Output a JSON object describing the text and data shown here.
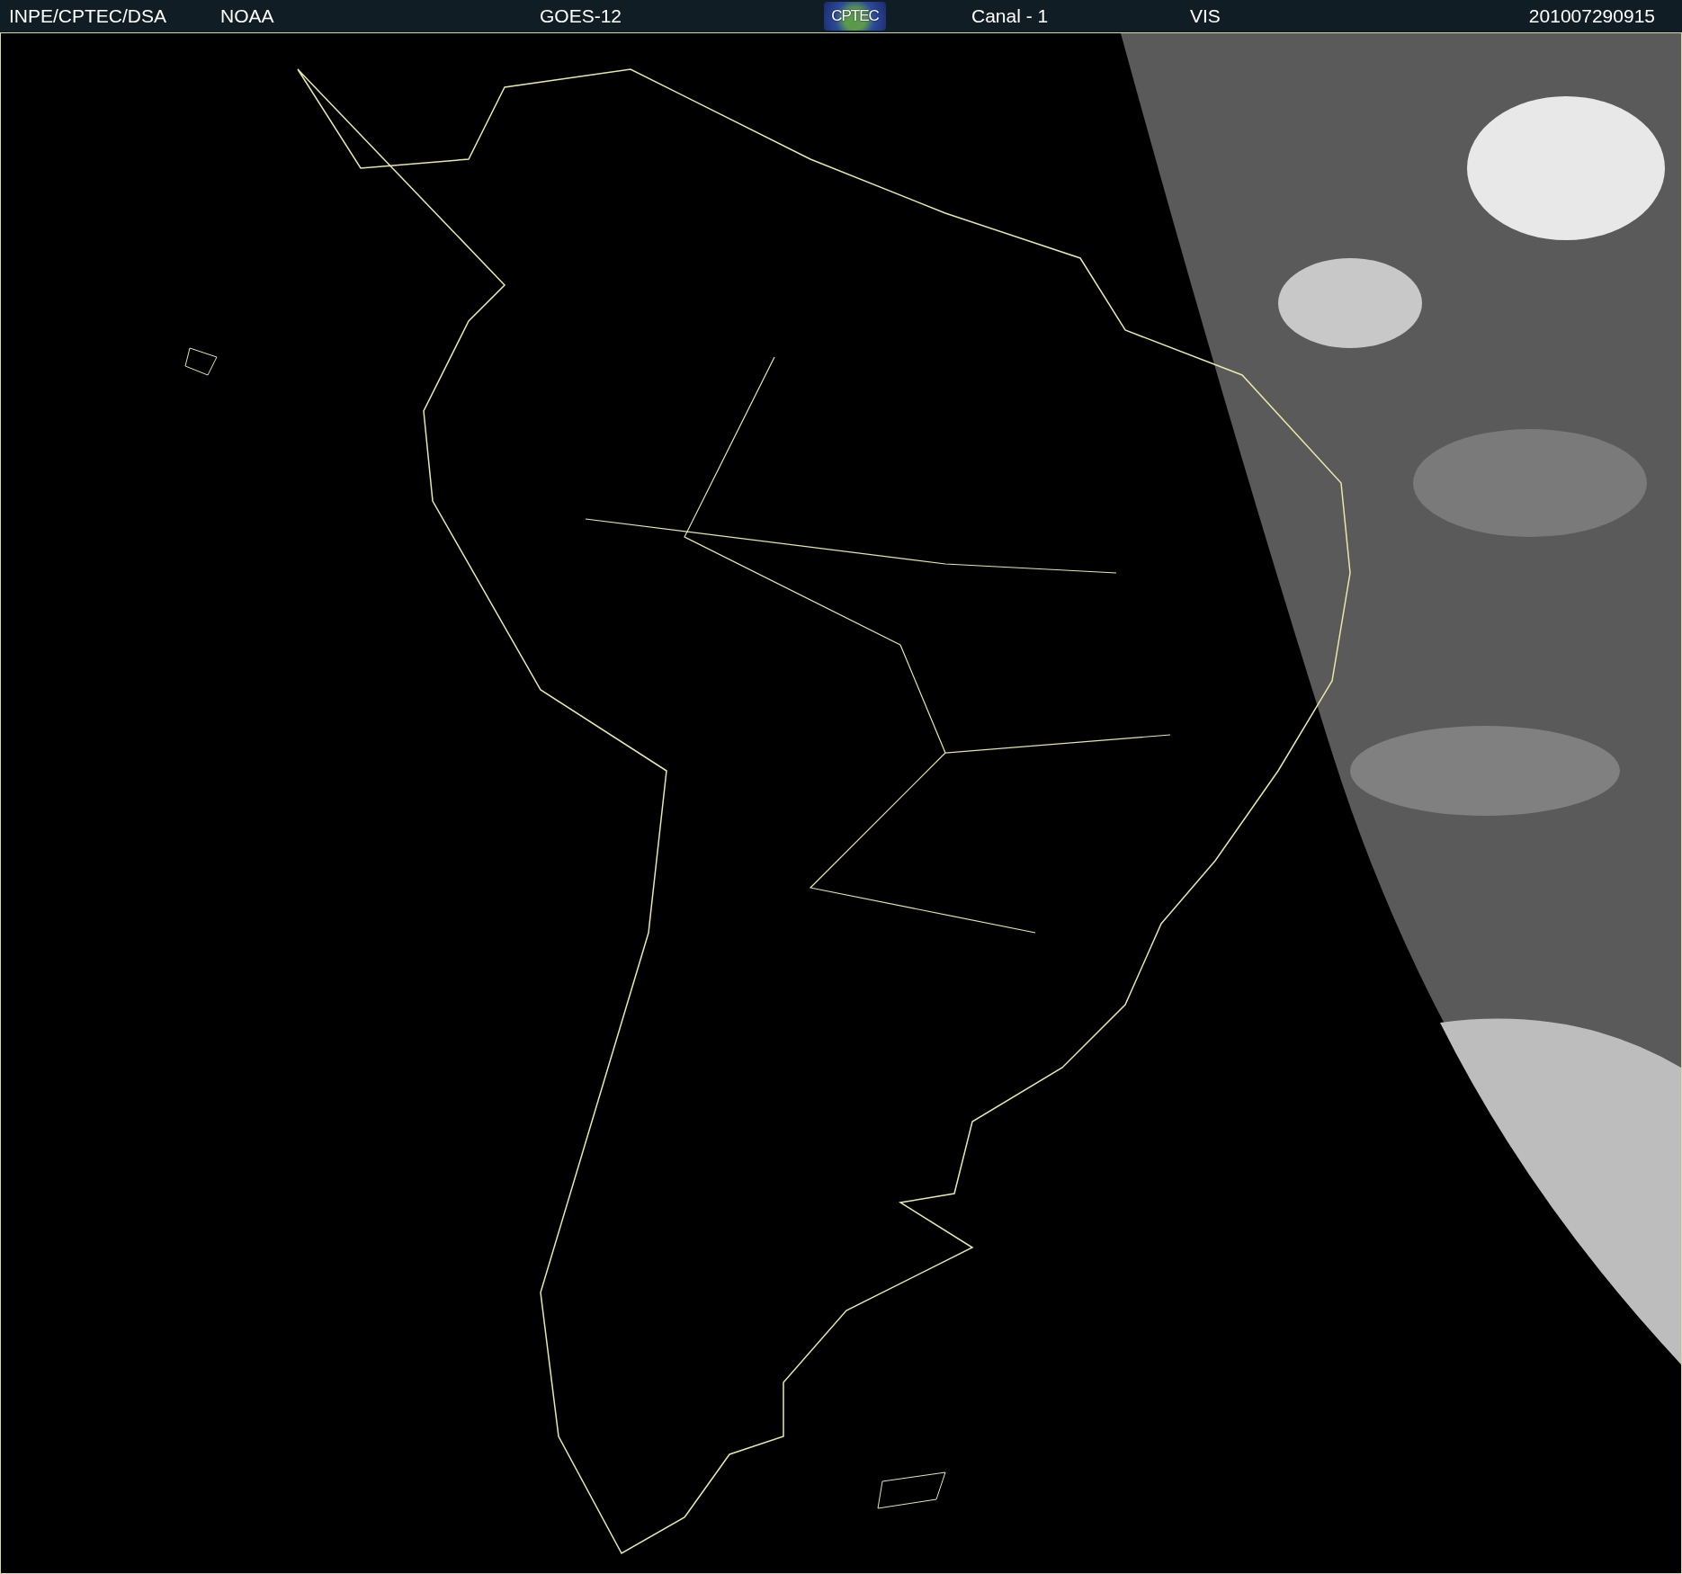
{
  "header": {
    "items": [
      {
        "kind": "text",
        "text": "INPE/CPTEC/DSA"
      },
      {
        "kind": "text",
        "text": "NOAA"
      },
      {
        "kind": "text",
        "text": "GOES-12"
      },
      {
        "kind": "logo",
        "text": "CPTEC"
      },
      {
        "kind": "text",
        "text": "Canal - 1"
      },
      {
        "kind": "text",
        "text": "VIS"
      },
      {
        "kind": "text",
        "text": "201007290915"
      }
    ]
  }
}
